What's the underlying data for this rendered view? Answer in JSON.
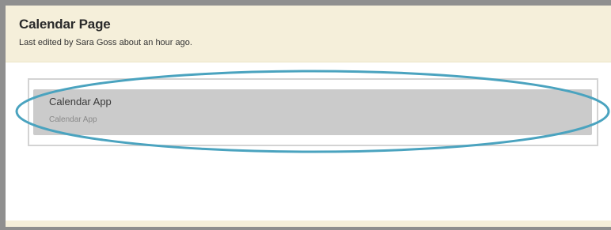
{
  "page": {
    "title": "Calendar Page",
    "last_edited": "Last edited by Sara Goss about an hour ago."
  },
  "app_tile": {
    "title": "Calendar App",
    "subtitle": "Calendar App"
  },
  "colors": {
    "header_bg": "#f5efda",
    "tile_bg": "#cbcbcb",
    "highlight_stroke": "#4aa3bf",
    "frame_border": "#8f8f8f"
  }
}
